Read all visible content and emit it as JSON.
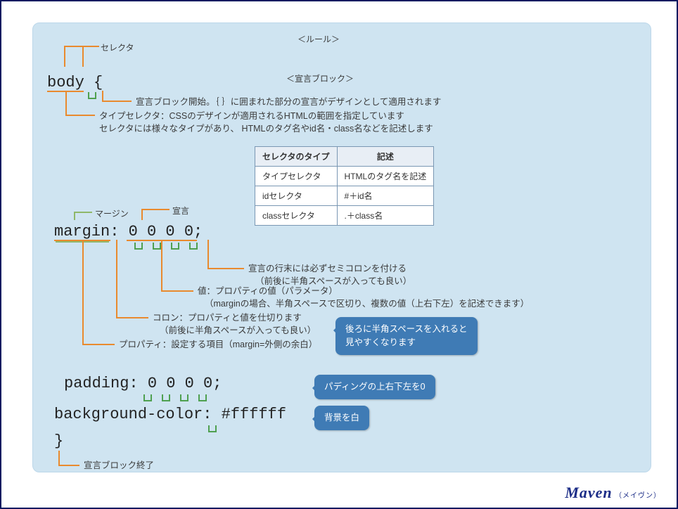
{
  "title_rule": "＜ルール＞",
  "title_block": "＜宣言ブロック＞",
  "lbl_selector": "セレクタ",
  "lbl_margin": "マージン",
  "lbl_decl": "宣言",
  "code": {
    "body_open": "body {",
    "margin": "margin: 0 0 0 0;",
    "padding": "padding: 0 0 0 0;",
    "bg": "background-color: #ffffff",
    "close": "}"
  },
  "notes": {
    "open_brace": "宣言ブロック開始。｛ ｝に囲まれた部分の宣言がデザインとして適用されます",
    "type_selector1": "タイプセレクタ：CSSのデザインが適用されるHTMLの範囲を指定しています",
    "type_selector2": "セレクタには様々なタイプがあり、 HTMLのタグ名やid名・class名などを記述します",
    "semicolon1": "宣言の行末には必ずセミコロンを付ける",
    "semicolon2": "（前後に半角スペースが入っても良い）",
    "value1": "値：プロパティの値（パラメータ）",
    "value2": "（marginの場合、半角スペースで区切り、複数の値（上右下左）を記述できます）",
    "colon1": "コロン：プロパティと値を仕切ります",
    "colon2": "（前後に半角スペースが入っても良い）",
    "property": "プロパティ：設定する項目（margin=外側の余白）",
    "close_brace": "宣言ブロック終了"
  },
  "bubbles": {
    "space_tip": "後ろに半角スペースを入れると\n見やすくなります",
    "padding_tip": "パディングの上右下左を0",
    "bg_tip": "背景を白"
  },
  "table": {
    "h1": "セレクタのタイプ",
    "h2": "記述",
    "r1c1": "タイプセレクタ",
    "r1c2": "HTMLのタグ名を記述",
    "r2c1": "idセレクタ",
    "r2c2": "#＋id名",
    "r3c1": "classセレクタ",
    "r3c2": ".＋class名"
  },
  "sig_main": "Maven",
  "sig_sub": "（メイヴン）"
}
